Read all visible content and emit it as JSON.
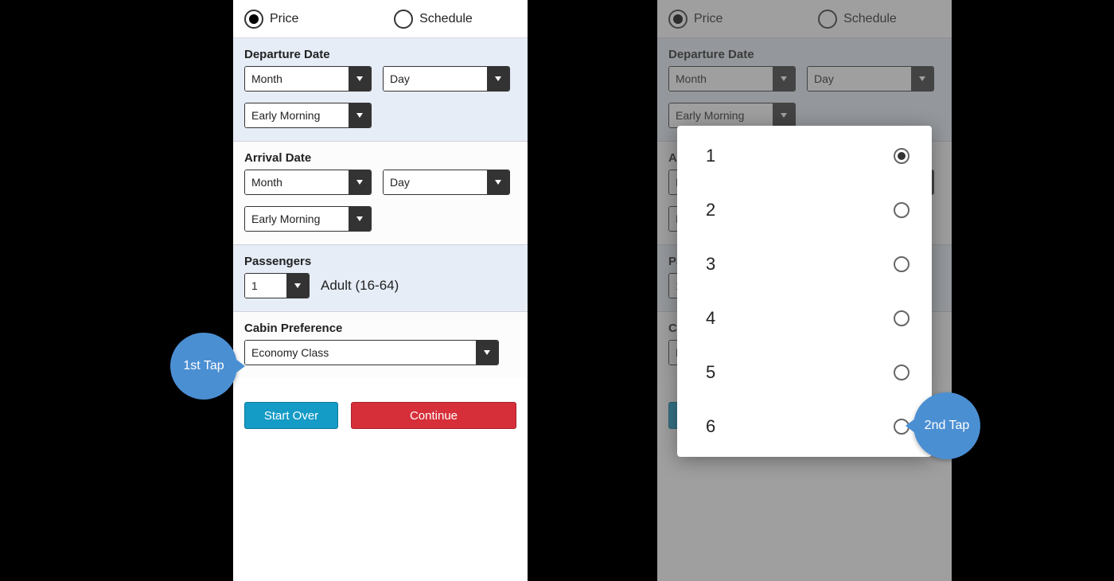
{
  "sortRow": {
    "price": "Price",
    "schedule": "Schedule"
  },
  "departure": {
    "label": "Departure Date",
    "month": "Month",
    "day": "Day",
    "time": "Early Morning"
  },
  "arrival": {
    "label": "Arrival Date",
    "month": "Month",
    "day": "Day",
    "time": "Early Morning"
  },
  "passengers": {
    "label": "Passengers",
    "value": "1",
    "ageGroup": "Adult (16-64)"
  },
  "cabin": {
    "label": "Cabin Preference",
    "value": "Economy Class"
  },
  "buttons": {
    "startOver": "Start Over",
    "continue": "Continue"
  },
  "popup": {
    "options": [
      "1",
      "2",
      "3",
      "4",
      "5",
      "6"
    ],
    "selected": "1"
  },
  "taps": {
    "first": "1st Tap",
    "second": "2nd Tap"
  }
}
